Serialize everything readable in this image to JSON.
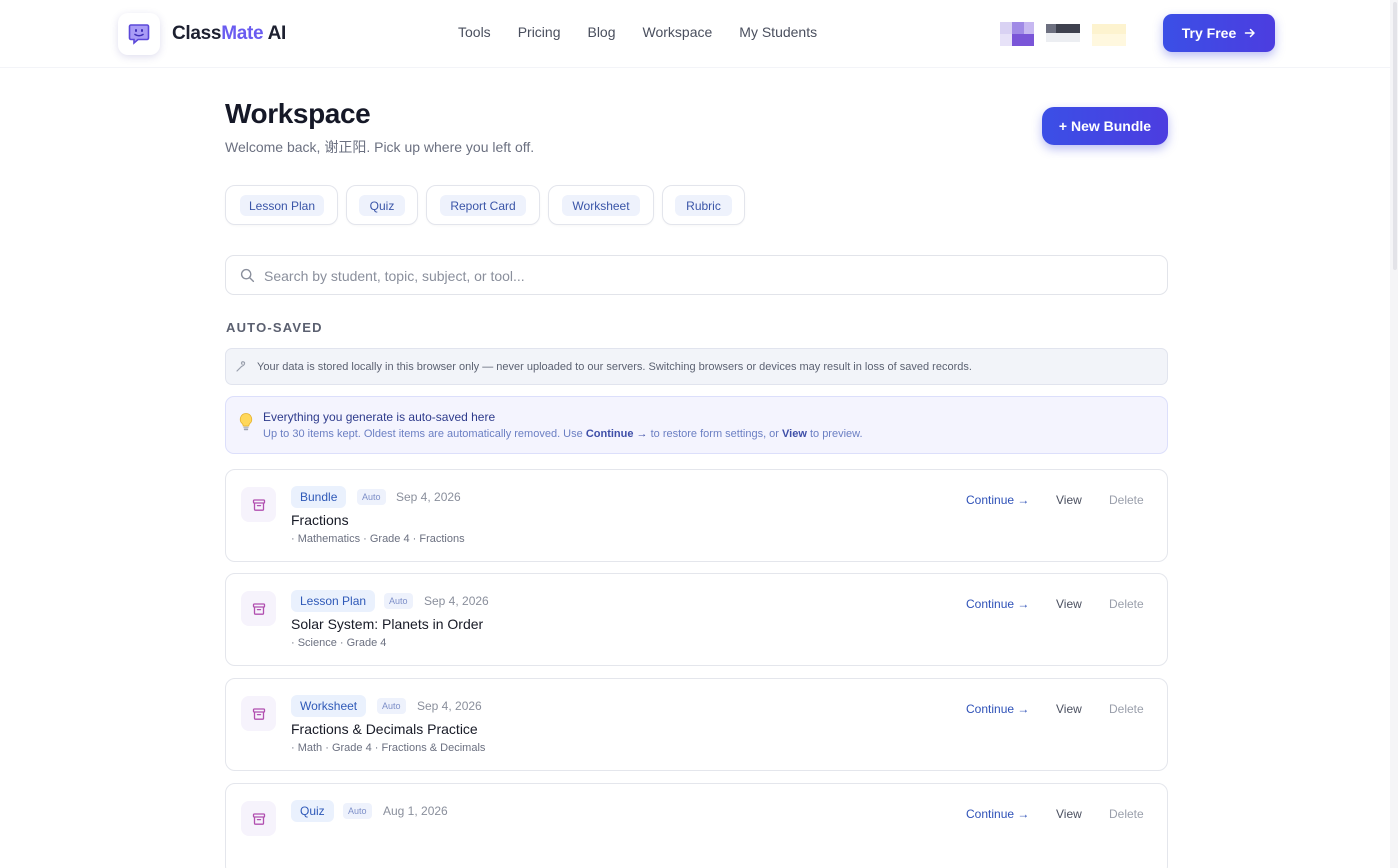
{
  "brand": {
    "name_main": "Class",
    "name_accent": "Mate",
    "name_suffix": " AI",
    "logo_icon": "chat-face-icon"
  },
  "nav": [
    "Tools",
    "Pricing",
    "Blog",
    "Workspace",
    "My Students"
  ],
  "header": {
    "try_label": "Try Free",
    "try_icon": "arrow-right-icon"
  },
  "page": {
    "title": "Workspace",
    "subtitle": "Welcome back, 谢正阳. Pick up where you left off.",
    "new_bundle_label": "+ New Bundle"
  },
  "tools": [
    "Lesson Plan",
    "Quiz",
    "Report Card",
    "Worksheet",
    "Rubric"
  ],
  "search": {
    "placeholder": "Search by student, topic, subject, or tool...",
    "icon": "search-icon"
  },
  "section": {
    "label": "AUTO-SAVED"
  },
  "notice": {
    "icon": "lock-icon",
    "text": "Your data is stored locally in this browser only — never uploaded to our servers. Switching browsers or devices may result in loss of saved records."
  },
  "tip": {
    "icon": "lightbulb-icon",
    "title": "Everything you generate is auto-saved here",
    "body_pre": "Up to 30 items kept. Oldest items are automatically removed. Use ",
    "body_continue": "Continue →",
    "body_mid": " to restore form settings, or ",
    "body_view": "View",
    "body_post": " to preview."
  },
  "actions": {
    "continue": "Continue →",
    "view": "View",
    "delete": "Delete"
  },
  "items": [
    {
      "type": "Bundle",
      "auto": "Auto",
      "date": "Sep 4, 2026",
      "title": "Fractions",
      "meta": "· Mathematics · Grade 4 · Fractions"
    },
    {
      "type": "Lesson Plan",
      "auto": "Auto",
      "date": "Sep 4, 2026",
      "title": "Solar System: Planets in Order",
      "meta": "· Science · Grade 4"
    },
    {
      "type": "Worksheet",
      "auto": "Auto",
      "date": "Sep 4, 2026",
      "title": "Fractions & Decimals Practice",
      "meta": "· Math · Grade 4 · Fractions & Decimals"
    },
    {
      "type": "Quiz",
      "auto": "Auto",
      "date": "Aug 1, 2026",
      "title": "",
      "meta": ""
    }
  ],
  "colors": {
    "accent": "#4c3de0",
    "brand_accent": "#6a5cf0",
    "chip_text": "#2f59b8"
  }
}
